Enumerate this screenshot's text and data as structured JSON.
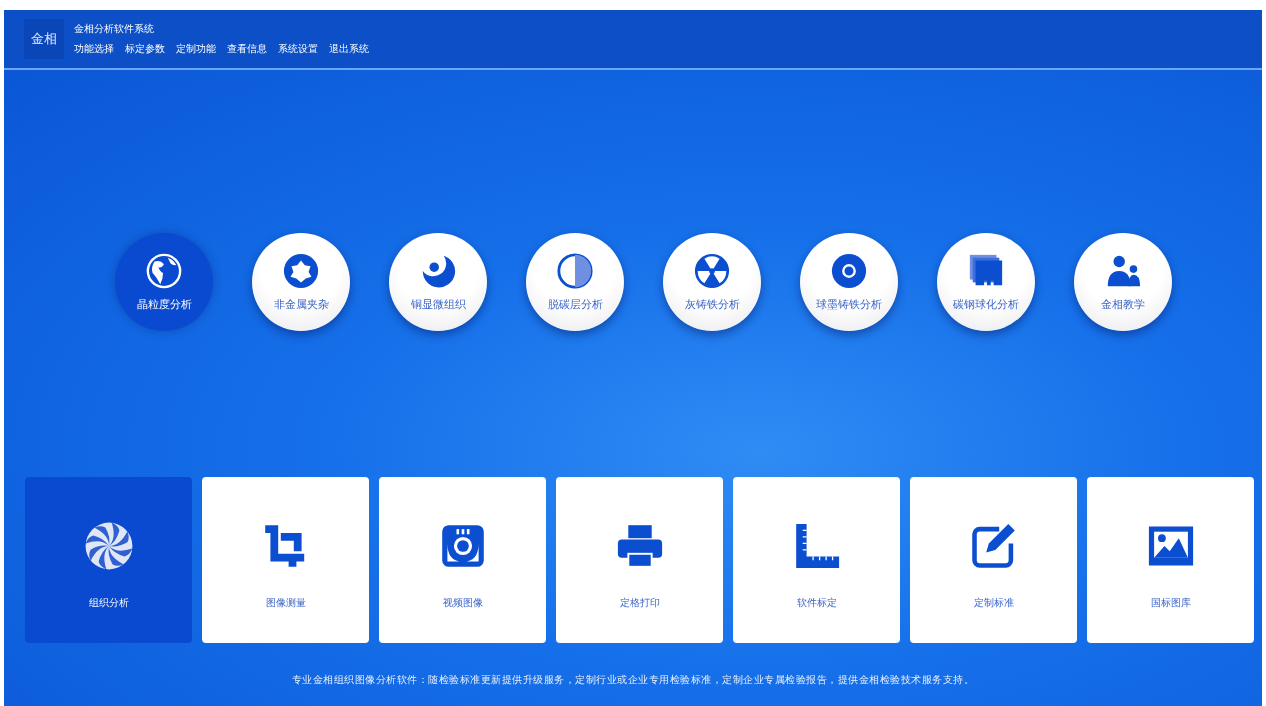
{
  "header": {
    "logo": "金相",
    "title": "金相分析软件系统",
    "menu": [
      "功能选择",
      "标定参数",
      "定制功能",
      "查看信息",
      "系统设置",
      "退出系统"
    ]
  },
  "analyses": [
    {
      "label": "晶粒度分析",
      "kind": "globe",
      "selected": true
    },
    {
      "label": "非金属夹杂",
      "kind": "flower",
      "selected": false
    },
    {
      "label": "铜显微组织",
      "kind": "moon",
      "selected": false
    },
    {
      "label": "脱碳层分析",
      "kind": "half",
      "selected": false
    },
    {
      "label": "灰铸铁分析",
      "kind": "radiation",
      "selected": false
    },
    {
      "label": "球墨铸铁分析",
      "kind": "disc",
      "selected": false
    },
    {
      "label": "碳钢球化分析",
      "kind": "layers",
      "selected": false
    },
    {
      "label": "金相教学",
      "kind": "people",
      "selected": false
    }
  ],
  "tools": [
    {
      "label": "组织分析",
      "kind": "swirl",
      "selected": true
    },
    {
      "label": "图像测量",
      "kind": "crop",
      "selected": false
    },
    {
      "label": "视频图像",
      "kind": "camera",
      "selected": false
    },
    {
      "label": "定格打印",
      "kind": "printer",
      "selected": false
    },
    {
      "label": "软件标定",
      "kind": "ruler",
      "selected": false
    },
    {
      "label": "定制标准",
      "kind": "edit",
      "selected": false
    },
    {
      "label": "国标图库",
      "kind": "image",
      "selected": false
    }
  ],
  "footer": "专业金相组织图像分析软件：随检验标准更新提供升级服务，定制行业或企业专用检验标准，定制企业专属检验报告，提供金相检验技术服务支持。"
}
